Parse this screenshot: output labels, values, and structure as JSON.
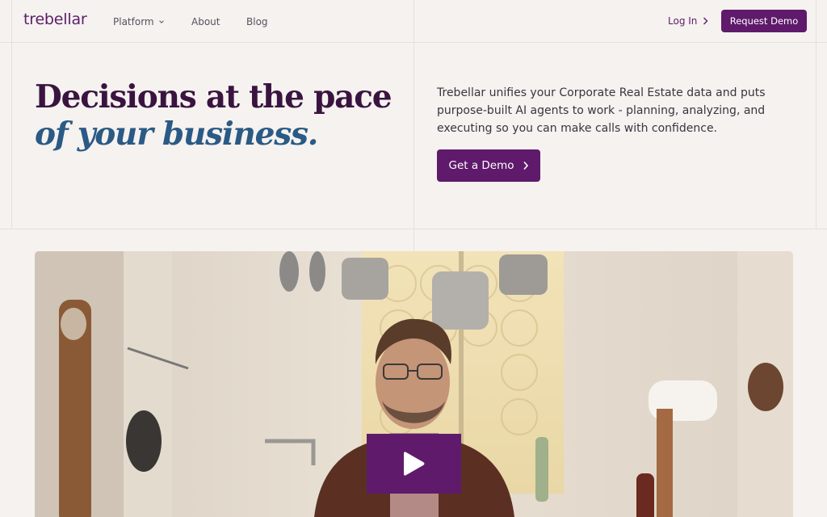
{
  "header": {
    "logo": "trebellar",
    "nav": [
      {
        "label": "Platform"
      },
      {
        "label": "About"
      },
      {
        "label": "Blog"
      }
    ],
    "login_label": "Log In",
    "request_demo_label": "Request Demo"
  },
  "hero": {
    "title_line1": "Decisions at the pace",
    "title_line2": "of your business.",
    "description": "Trebellar unifies your Corporate Real Estate data and puts purpose-built AI agents to work - planning, analyzing, and executing so you can make calls with confidence.",
    "cta_label": "Get a Demo"
  },
  "video": {
    "play_icon": "play-icon"
  },
  "colors": {
    "brand": "#5f1a6b",
    "title": "#3a1440",
    "accent_blue": "#2a5a85",
    "background": "#f5f2ef"
  }
}
